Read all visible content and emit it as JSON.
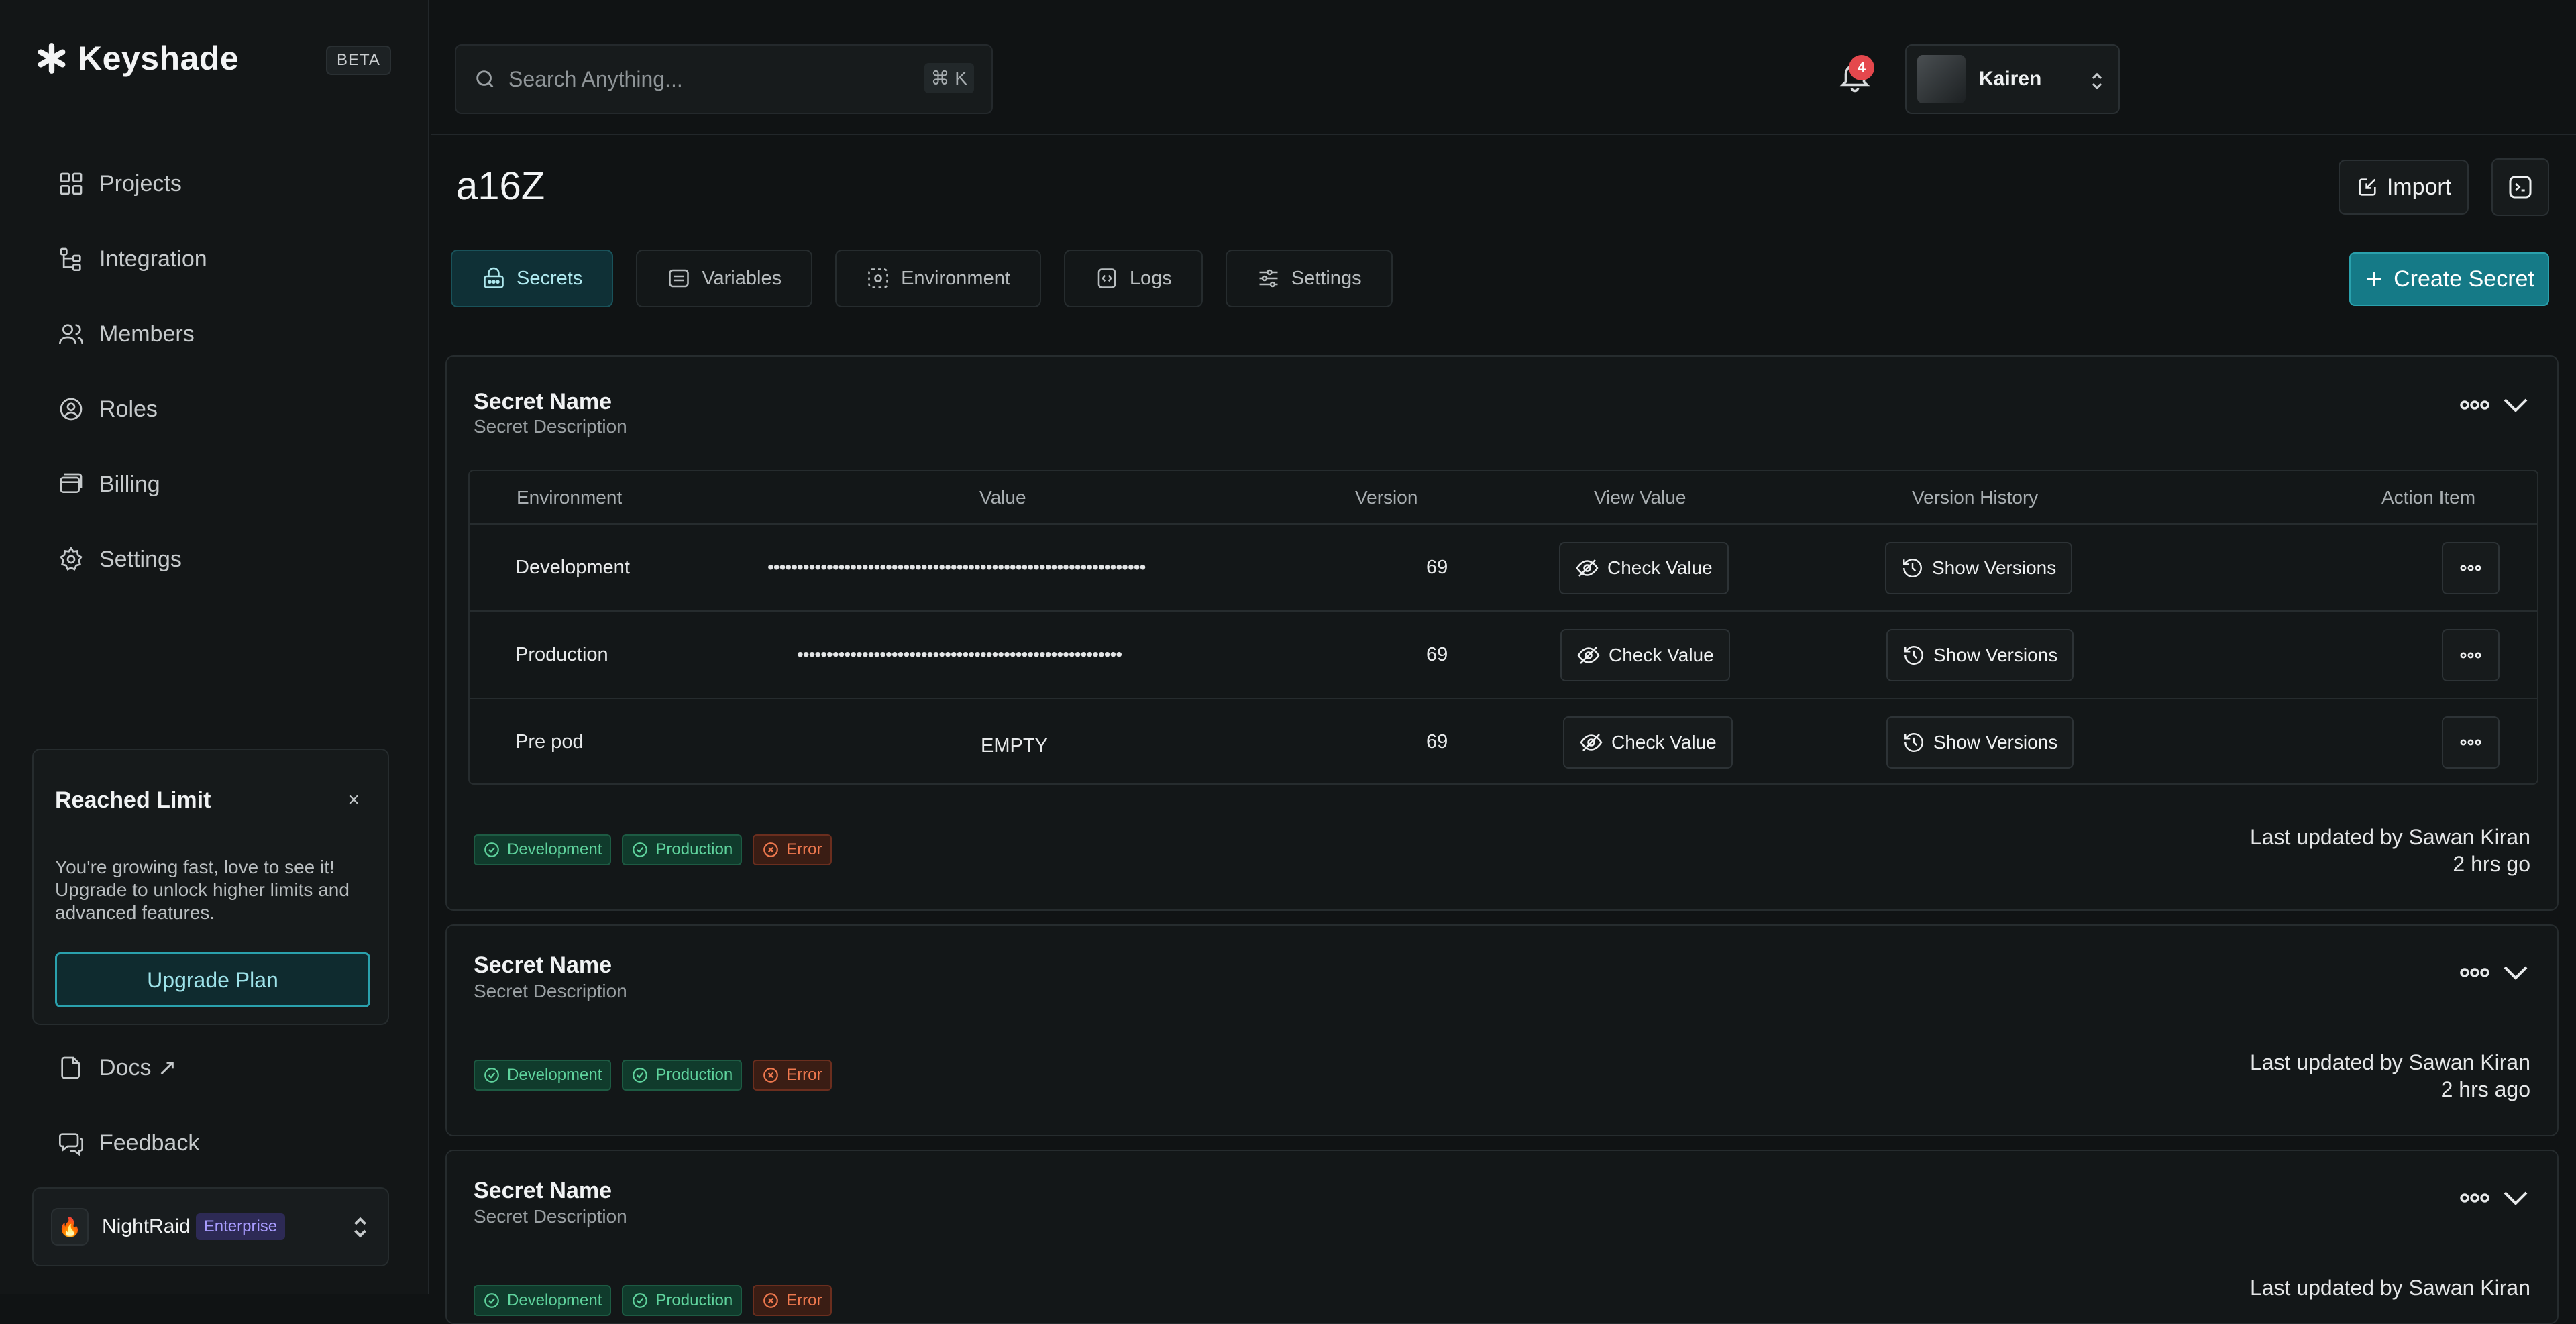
{
  "app": {
    "name": "Keyshade",
    "beta_label": "BETA"
  },
  "sidebar": {
    "items": [
      {
        "label": "Projects",
        "icon": "grid-icon"
      },
      {
        "label": "Integration",
        "icon": "integration-icon"
      },
      {
        "label": "Members",
        "icon": "members-icon"
      },
      {
        "label": "Roles",
        "icon": "roles-icon"
      },
      {
        "label": "Billing",
        "icon": "billing-icon"
      },
      {
        "label": "Settings",
        "icon": "gear-icon"
      }
    ],
    "limit_card": {
      "title": "Reached Limit",
      "close": "×",
      "text": "You're growing fast, love to see it! Upgrade to unlock higher limits and advanced features.",
      "button": "Upgrade Plan"
    },
    "docs": "Docs ↗",
    "feedback": "Feedback",
    "workspace": {
      "emoji": "🔥",
      "name": "NightRaid",
      "badge": "Enterprise"
    }
  },
  "topbar": {
    "search_placeholder": "Search Anything...",
    "shortcut": "⌘ K",
    "notification_count": "4",
    "user_name": "Kairen"
  },
  "page": {
    "title": "a16Z",
    "import_label": "Import",
    "create_label": "Create Secret",
    "tabs": [
      {
        "label": "Secrets",
        "active": true
      },
      {
        "label": "Variables",
        "active": false
      },
      {
        "label": "Environment",
        "active": false
      },
      {
        "label": "Logs",
        "active": false
      },
      {
        "label": "Settings",
        "active": false
      }
    ]
  },
  "table_headers": [
    "Environment",
    "Value",
    "Version",
    "View Value",
    "Version History",
    "Action Item"
  ],
  "secrets": [
    {
      "name": "Secret Name",
      "description": "Secret Description",
      "rows": [
        {
          "environment": "Development",
          "value": "••••••••••••••••••••••••••••••••••••••••••••••••••••••••••••••••",
          "version": "69",
          "check": "Check Value",
          "versions": "Show Versions"
        },
        {
          "environment": "Production",
          "value": "•••••••••••••••••••••••••••••••••••••••••••••••••••••••",
          "version": "69",
          "check": "Check Value",
          "versions": "Show Versions"
        },
        {
          "environment": "Pre pod",
          "value": "EMPTY",
          "version": "69",
          "check": "Check Value",
          "versions": "Show Versions"
        }
      ],
      "tags": [
        "Development",
        "Production",
        "Error"
      ],
      "updated_by": "Last updated by Sawan Kiran",
      "updated_ago": "2 hrs go"
    },
    {
      "name": "Secret Name",
      "description": "Secret Description",
      "tags": [
        "Development",
        "Production",
        "Error"
      ],
      "updated_by": "Last updated by Sawan Kiran",
      "updated_ago": "2 hrs ago"
    },
    {
      "name": "Secret Name",
      "description": "Secret Description",
      "tags": [
        "Development",
        "Production",
        "Error"
      ],
      "updated_by": "Last updated by Sawan Kiran"
    }
  ],
  "colors": {
    "accent": "#157a87",
    "success": "#5fd39d",
    "error": "#f0794f",
    "badge": "#e5484d"
  }
}
